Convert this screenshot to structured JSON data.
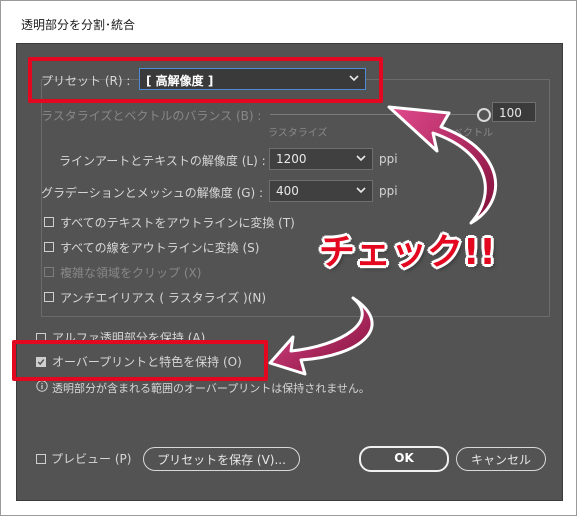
{
  "window": {
    "title": "透明部分を分割･統合"
  },
  "preset": {
    "label": "プリセット (R) :",
    "value": "[ 高解像度 ]"
  },
  "balance": {
    "label": "ラスタライズとベクトルのバランス (B) :",
    "value": "100",
    "left_label": "ラスタライズ",
    "right_label": "ベクトル",
    "level_percent": 100
  },
  "line_art": {
    "label": "ラインアートとテキストの解像度 (L) :",
    "value": "1200",
    "unit": "ppi"
  },
  "gradient": {
    "label": "グラデーションとメッシュの解像度 (G) :",
    "value": "400",
    "unit": "ppi"
  },
  "options": [
    {
      "label": "すべてのテキストをアウトラインに変換 (T)",
      "checked": false,
      "enabled": true
    },
    {
      "label": "すべての線をアウトラインに変換 (S)",
      "checked": false,
      "enabled": true
    },
    {
      "label": "複雑な領域をクリップ (X)",
      "checked": false,
      "enabled": false
    },
    {
      "label": "アンチエイリアス ( ラスタライズ )(N)",
      "checked": false,
      "enabled": true
    }
  ],
  "alpha": {
    "label": "アルファ透明部分を保持 (A)",
    "checked": false
  },
  "overprint": {
    "label": "オーバープリントと特色を保持 (O)",
    "checked": true
  },
  "info": {
    "icon": "info-icon",
    "text": "透明部分が含まれる範囲のオーバープリントは保持されません。"
  },
  "preview": {
    "label": "プレビュー (P)",
    "checked": false
  },
  "buttons": {
    "save_preset": "プリセットを保存 (V)...",
    "ok": "OK",
    "cancel": "キャンセル"
  },
  "annotation": {
    "text": "チェック!!",
    "color": "#e3081f",
    "arrow_color": "#c0135a"
  }
}
